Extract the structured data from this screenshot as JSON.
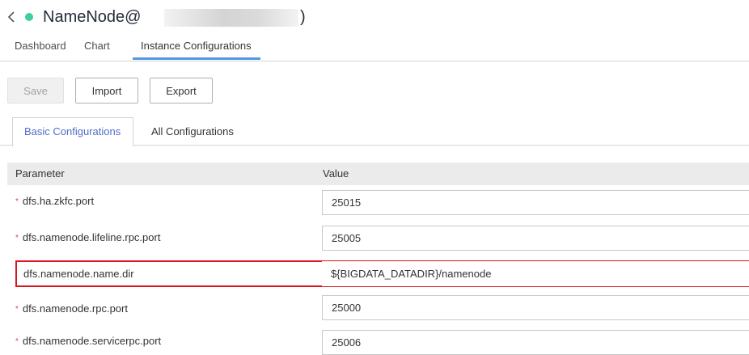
{
  "header": {
    "title": "NameNode@",
    "title_suffix": ")",
    "status_color": "#3ccfa0"
  },
  "main_tabs": [
    {
      "label": "Dashboard"
    },
    {
      "label": "Chart"
    },
    {
      "label": "Instance Configurations",
      "active": true
    }
  ],
  "toolbar": {
    "save_label": "Save",
    "import_label": "Import",
    "export_label": "Export"
  },
  "sub_tabs": [
    {
      "label": "Basic Configurations",
      "active": true
    },
    {
      "label": "All Configurations"
    }
  ],
  "table": {
    "columns": [
      "Parameter",
      "Value"
    ],
    "rows": [
      {
        "param": "dfs.ha.zkfc.port",
        "value": "25015",
        "required": true
      },
      {
        "param": "dfs.namenode.lifeline.rpc.port",
        "value": "25005",
        "required": true
      },
      {
        "param": "dfs.namenode.name.dir",
        "value": "${BIGDATA_DATADIR}/namenode",
        "required": false,
        "highlighted": true
      },
      {
        "param": "dfs.namenode.rpc.port",
        "value": "25000",
        "required": true
      },
      {
        "param": "dfs.namenode.servicerpc.port",
        "value": "25006",
        "required": true
      }
    ]
  },
  "colors": {
    "accent": "#5596e6",
    "active_tab_text": "#526ecc",
    "required_marker": "#e9453f",
    "highlight_border": "#d9161f"
  }
}
